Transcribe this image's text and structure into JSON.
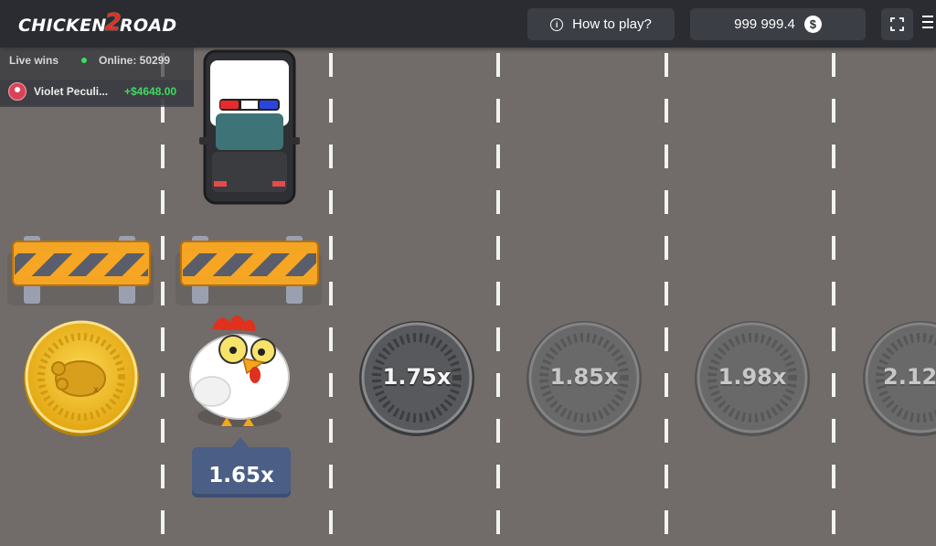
{
  "header": {
    "logo_left": "CHICKEN",
    "logo_number": "2",
    "logo_right": "ROAD",
    "how_to_play": "How to play?",
    "balance": "999 999.4",
    "currency_symbol": "$"
  },
  "live_wins": {
    "title": "Live wins",
    "online": "Online: 50299",
    "entry_name": "Violet Peculi...",
    "entry_amount": "+$4648.00"
  },
  "lanes": [
    {
      "multiplier": "",
      "state": "passed"
    },
    {
      "multiplier": "1.65x",
      "state": "current"
    },
    {
      "multiplier": "1.75x",
      "state": "next"
    },
    {
      "multiplier": "1.85x",
      "state": "locked"
    },
    {
      "multiplier": "1.98x",
      "state": "locked"
    },
    {
      "multiplier": "2.12",
      "state": "locked"
    }
  ],
  "icons": {
    "car": "police-car-icon",
    "barrier": "barrier-icon",
    "chicken": "chicken-icon"
  },
  "colors": {
    "road": "#716c69",
    "header": "#2a2c31",
    "gold_coin": "#f1c232",
    "tag": "#4b5e86",
    "win_green": "#3ddc5f"
  }
}
